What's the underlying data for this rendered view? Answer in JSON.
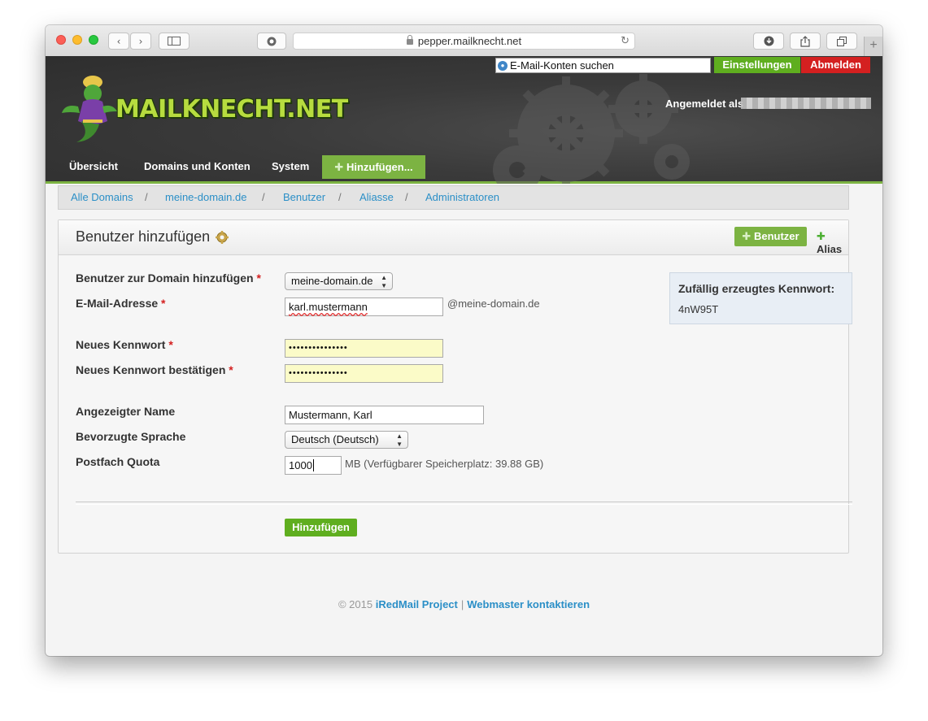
{
  "browser": {
    "url": "pepper.mailknecht.net"
  },
  "header": {
    "search_placeholder": "E-Mail-Konten suchen",
    "settings_label": "Einstellungen",
    "logout_label": "Abmelden",
    "logged_in_label": "Angemeldet als",
    "logo_text": "MAILKNECHT.NET"
  },
  "nav": {
    "items": [
      "Übersicht",
      "Domains und Konten",
      "System"
    ],
    "add_label": "Hinzufügen..."
  },
  "breadcrumb": [
    "Alle Domains",
    "meine-domain.de",
    "Benutzer",
    "Aliasse",
    "Administratoren"
  ],
  "panel": {
    "title": "Benutzer hinzufügen",
    "tab_user": "Benutzer",
    "tab_alias": "Alias"
  },
  "form": {
    "domain_label": "Benutzer zur Domain hinzufügen",
    "domain_value": "meine-domain.de",
    "email_label": "E-Mail-Adresse",
    "email_value": "karl.mustermann",
    "email_suffix": "@meine-domain.de",
    "password_label": "Neues Kennwort",
    "password_value": "•••••••••••••••",
    "password_confirm_label": "Neues Kennwort bestätigen",
    "password_confirm_value": "•••••••••••••••",
    "display_name_label": "Angezeigter Name",
    "display_name_value": "Mustermann, Karl",
    "language_label": "Bevorzugte Sprache",
    "language_value": "Deutsch (Deutsch)",
    "quota_label": "Postfach Quota",
    "quota_value": "1000",
    "quota_suffix": "MB (Verfügbarer Speicherplatz: 39.88 GB)",
    "submit_label": "Hinzufügen",
    "required_mark": "*"
  },
  "generated_password": {
    "title": "Zufällig erzeugtes Kennwort:",
    "value": "4nW95T"
  },
  "footer": {
    "copyright": "© 2015",
    "project_link": "iRedMail Project",
    "separator": "|",
    "contact_link": "Webmaster kontaktieren"
  }
}
